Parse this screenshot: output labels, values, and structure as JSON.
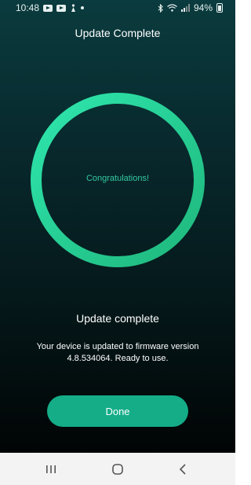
{
  "status_bar": {
    "time": "10:48",
    "battery": "94%"
  },
  "header": {
    "title": "Update Complete"
  },
  "progress_ring": {
    "label": "Congratulations!",
    "progress": 1.0,
    "color_start": "#2ee6ad",
    "color_end": "#1fb77c"
  },
  "result": {
    "heading": "Update complete",
    "message": "Your device is updated to firmware version 4.8.534064. Ready to use."
  },
  "actions": {
    "done_label": "Done"
  },
  "colors": {
    "accent": "#14ad88",
    "ring_text": "#35c7a1",
    "background_top": "#0a3b3e",
    "background_bottom": "#000000"
  },
  "icons": {
    "status_left": [
      "youtube-icon",
      "youtube-icon",
      "notification-icon",
      "dot-icon"
    ],
    "status_right": [
      "bluetooth-icon",
      "wifi-icon",
      "signal-icon",
      "battery-icon"
    ],
    "nav": [
      "recent-apps-icon",
      "home-icon",
      "back-icon"
    ]
  }
}
